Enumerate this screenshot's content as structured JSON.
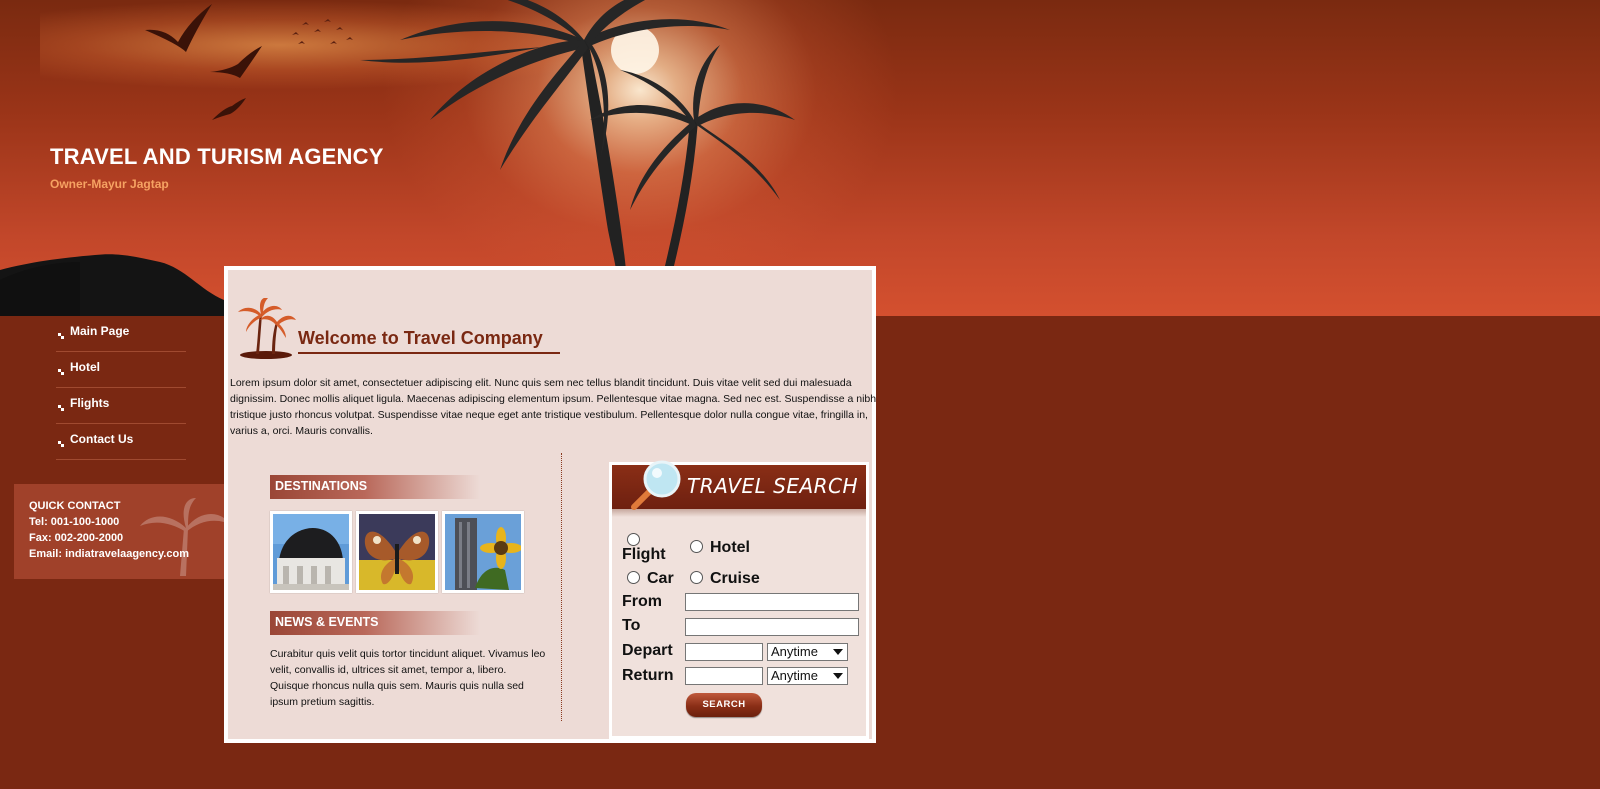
{
  "site": {
    "title": "TRAVEL AND TURISM AGENCY",
    "owner": "Owner-Mayur Jagtap"
  },
  "nav": {
    "items": [
      {
        "label": "Main Page"
      },
      {
        "label": "Hotel"
      },
      {
        "label": "Flights"
      },
      {
        "label": "Contact Us"
      }
    ]
  },
  "quick_contact": {
    "heading": "QUICK CONTACT",
    "tel": "Tel: 001-100-1000",
    "fax": "Fax: 002-200-2000",
    "email": "Email: indiatravelaagency.com"
  },
  "main": {
    "welcome_title": "Welcome to Travel Company",
    "intro": "Lorem ipsum dolor sit amet, consectetuer adipiscing elit. Nunc quis sem nec tellus blandit tincidunt. Duis vitae velit sed dui malesuada dignissim. Donec mollis aliquet ligula. Maecenas adipiscing elementum ipsum. Pellentesque vitae magna. Sed nec est. Suspendisse a nibh tristique justo rhoncus volutpat. Suspendisse vitae neque eget ante tristique vestibulum. Pellentesque dolor nulla congue vitae, fringilla in, varius a, orci. Mauris convallis.",
    "destinations_heading": "DESTINATIONS",
    "news_heading": "NEWS & EVENTS",
    "news_text": "Curabitur quis velit quis tortor tincidunt aliquet. Vivamus leo velit, convallis id, ultrices sit amet, tempor a, libero. Quisque rhoncus nulla quis sem. Mauris quis nulla sed ipsum pretium sagittis."
  },
  "search": {
    "title": "TRAVEL SEARCH",
    "options": {
      "flight": "Flight",
      "hotel": "Hotel",
      "car": "Car",
      "cruise": "Cruise"
    },
    "labels": {
      "from": "From",
      "to": "To",
      "depart": "Depart",
      "return": "Return"
    },
    "from_value": "",
    "to_value": "",
    "depart_value": "",
    "return_value": "",
    "depart_time": "Anytime",
    "return_time": "Anytime",
    "button": "SEARCH"
  },
  "colors": {
    "background": "#7a2812",
    "panel": "#eddbd6",
    "accent": "#7a2812",
    "owner_text": "#f6a262"
  },
  "icons": [
    "bullet-icon",
    "palm-tree-icon",
    "magnifier-icon"
  ]
}
